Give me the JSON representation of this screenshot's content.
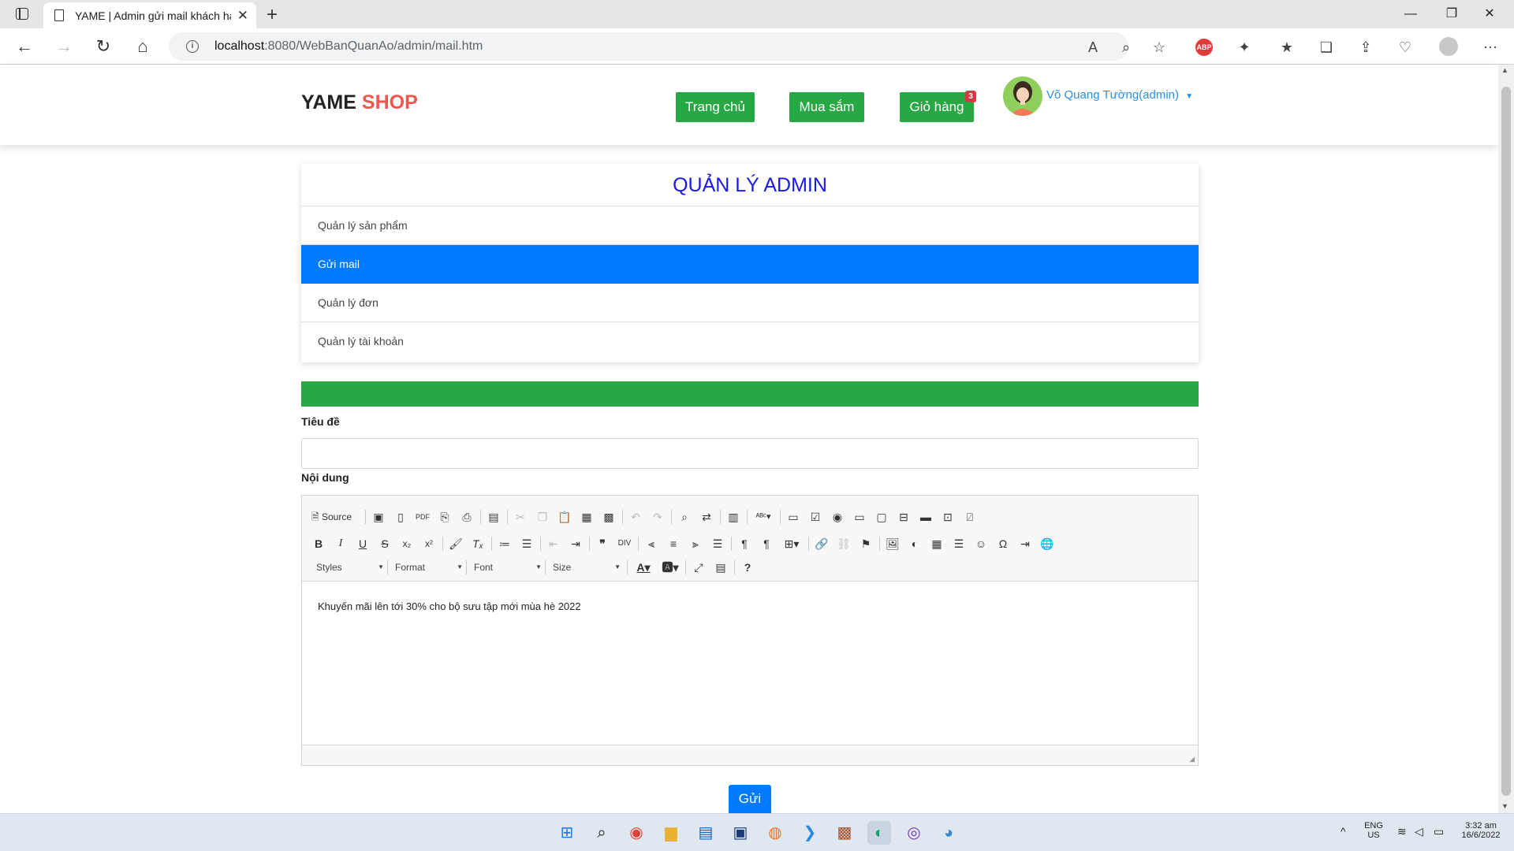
{
  "browser": {
    "tab_title": "YAME | Admin gửi mail khách hà",
    "url_host": "localhost",
    "url_rest": ":8080/WebBanQuanAo/admin/mail.htm"
  },
  "header": {
    "brand_main": "YAME",
    "brand_accent": "SHOP",
    "nav": [
      "Trang chủ",
      "Mua sắm",
      "Giỏ hàng"
    ],
    "cart_count": "3",
    "user_name": "Võ Quang Tường(admin)"
  },
  "admin": {
    "title": "QUẢN LÝ ADMIN",
    "menu": [
      "Quản lý sản phẩm",
      "Gửi mail",
      "Quản lý đơn",
      "Quản lý tài khoản"
    ],
    "active_index": 1
  },
  "form": {
    "subject_label": "Tiêu đề",
    "subject_value": "",
    "content_label": "Nội dung",
    "editor_text": "Khuyến mãi lên tới 30% cho bộ sưu tập mới mùa hè 2022",
    "send_label": "Gửi"
  },
  "editor_toolbar": {
    "source_label": "Source",
    "styles_label": "Styles",
    "format_label": "Format",
    "font_label": "Font",
    "size_label": "Size"
  },
  "system": {
    "lang": "ENG",
    "region": "US",
    "time": "3:32 am",
    "date": "16/6/2022"
  },
  "colors": {
    "brand_accent": "#f0554e",
    "nav_button": "#28a745",
    "active_menu": "#007bff",
    "admin_title": "#1a1ae6"
  }
}
